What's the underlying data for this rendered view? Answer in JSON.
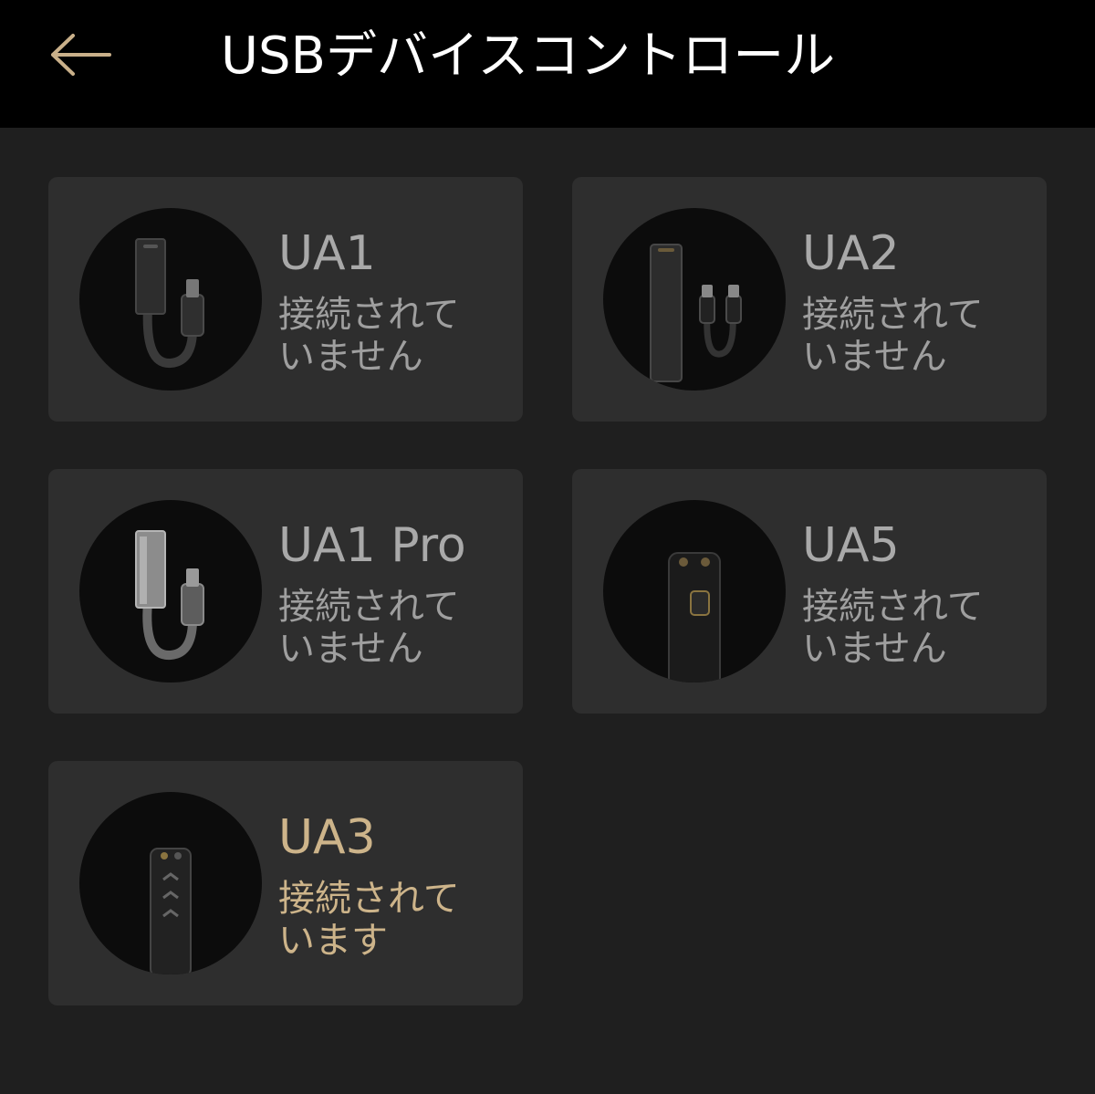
{
  "header": {
    "title": "USBデバイスコントロール",
    "back_icon": "arrow-left-icon",
    "accent_color": "#c9b08a"
  },
  "devices": [
    {
      "name": "UA1",
      "status": "接続されていません",
      "connected": false,
      "icon": "ua1-device-icon"
    },
    {
      "name": "UA2",
      "status": "接続されていません",
      "connected": false,
      "icon": "ua2-device-icon"
    },
    {
      "name": "UA1 Pro",
      "status": "接続されていません",
      "connected": false,
      "icon": "ua1-pro-device-icon"
    },
    {
      "name": "UA5",
      "status": "接続されていません",
      "connected": false,
      "icon": "ua5-device-icon"
    },
    {
      "name": "UA3",
      "status": "接続されています",
      "connected": true,
      "icon": "ua3-device-icon"
    }
  ],
  "colors": {
    "background": "#1f1f1f",
    "header_background": "#000000",
    "card_background": "#2e2e2e",
    "inactive_text": "#a9a9a9",
    "connected_text": "#cdb48a"
  }
}
